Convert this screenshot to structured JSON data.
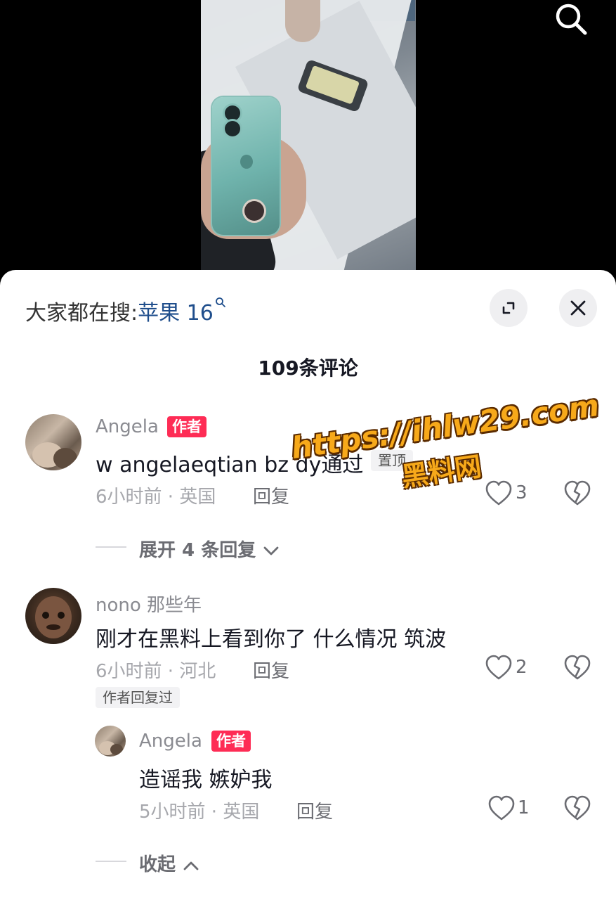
{
  "video": {
    "search_icon": "search-icon"
  },
  "hot_search": {
    "prefix": "大家都在搜:",
    "keyword": "苹果 16"
  },
  "comment_count": "109条评论",
  "comments": [
    {
      "user": "Angela",
      "author_badge": "作者",
      "text": "w angelaeqtian bz dy通过",
      "pinned_label": "置顶",
      "meta": "6小时前 · 英国",
      "reply_label": "回复",
      "likes": "3",
      "expand_label": "展开 4 条回复"
    },
    {
      "user": "nono 那些年",
      "text": "刚才在黑料上看到你了 什么情况 筑波",
      "meta": "6小时前 · 河北",
      "reply_label": "回复",
      "likes": "2",
      "author_replied_label": "作者回复过",
      "replies": [
        {
          "user": "Angela",
          "author_badge": "作者",
          "text": "造谣我 嫉妒我",
          "meta": "5小时前 · 英国",
          "reply_label": "回复",
          "likes": "1"
        }
      ],
      "collapse_label": "收起"
    }
  ],
  "watermark": {
    "line1": "https://ihlw29.com",
    "line2": "黑料网"
  },
  "colors": {
    "author_badge": "#fe2c55",
    "keyword": "#1f4e8c",
    "watermark": "#f7a91a"
  }
}
